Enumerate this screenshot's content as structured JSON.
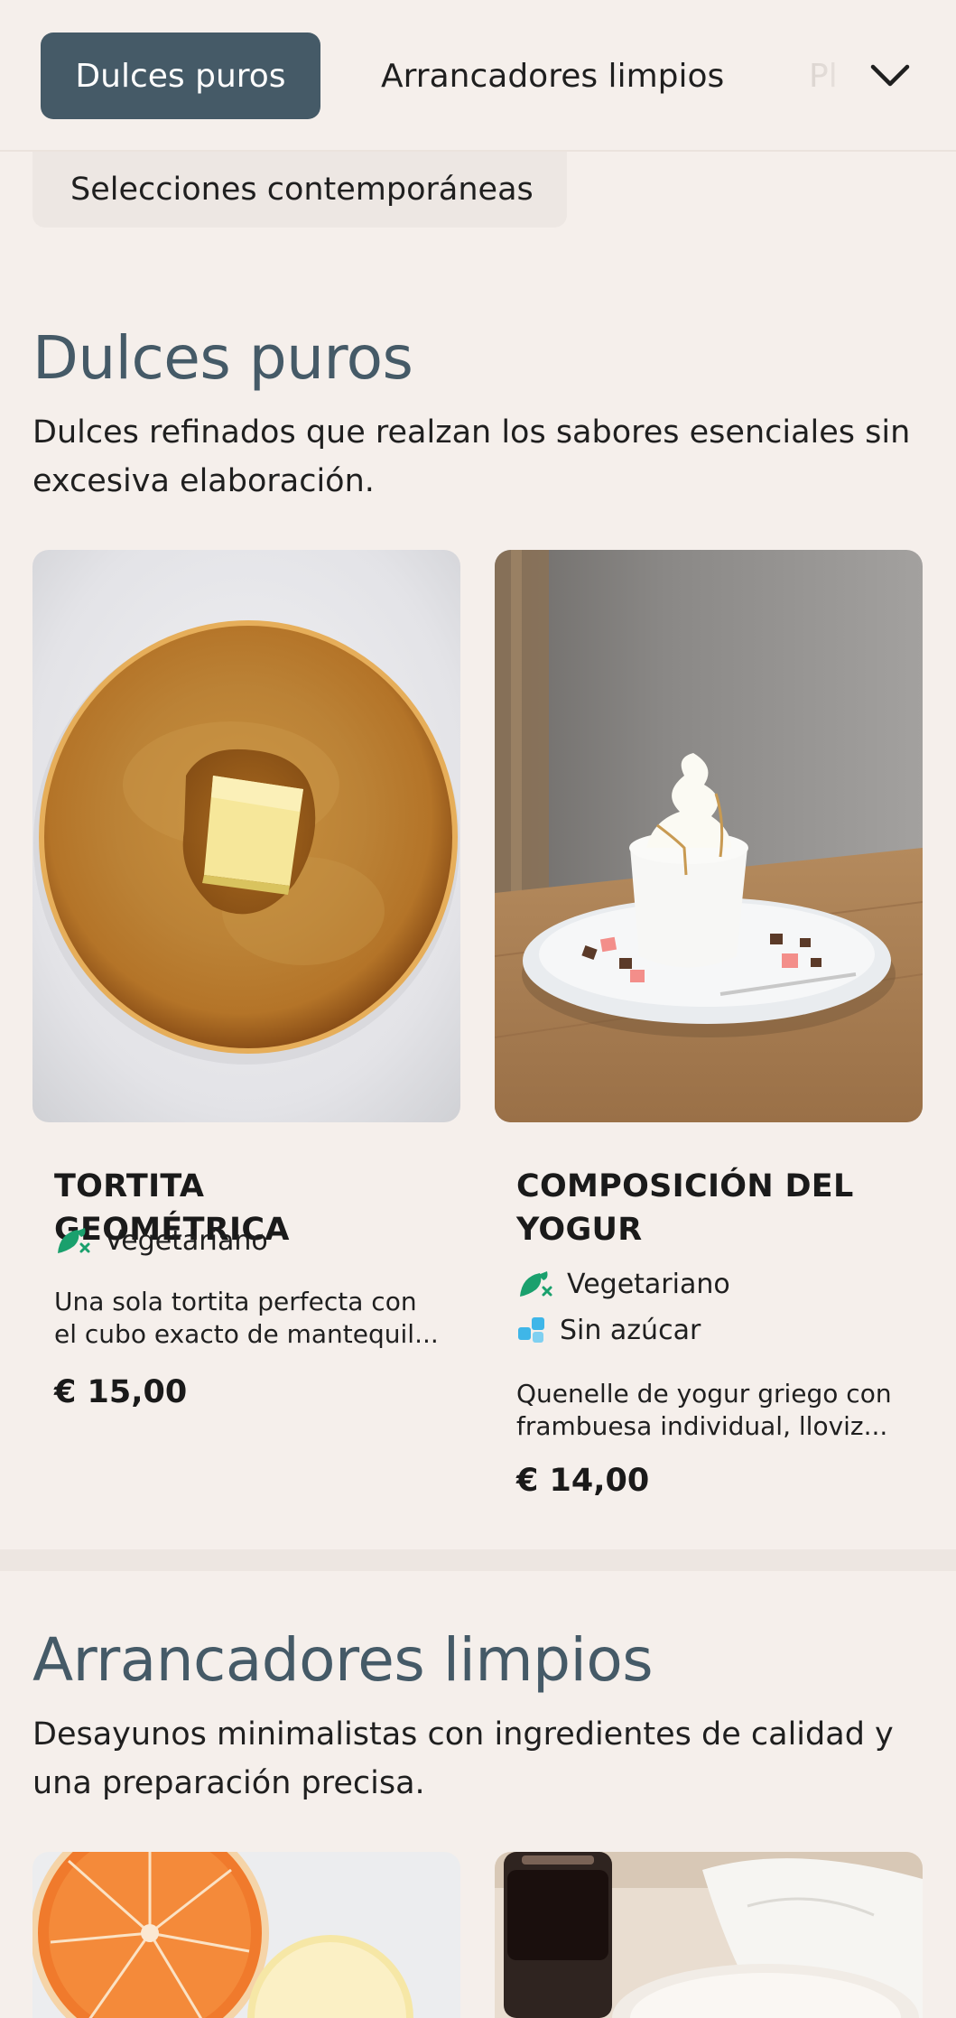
{
  "nav": {
    "tabs": [
      {
        "label": "Dulces puros",
        "active": true
      },
      {
        "label": "Arrancadores limpios",
        "active": false
      },
      {
        "label": "Pl",
        "active": false
      },
      {
        "label": "Selecciones contemporáneas",
        "active": false
      }
    ],
    "expand_icon": "chevron-down-icon"
  },
  "sections": [
    {
      "title": "Dulces puros",
      "description": "Dulces refinados que realzan los sabores esenciales sin excesiva elaboración.",
      "description_lines": [
        "Dulces refinados que realzan los sabores esenciales sin",
        "excesiva elaboración."
      ],
      "items": [
        {
          "name": "TORTITA GEOMÉTRICA",
          "tags": [
            {
              "icon": "leaf-drumstick-icon",
              "label": "Vegetariano"
            }
          ],
          "description_lines": [
            "Una sola tortita perfecta con",
            "el cubo exacto de mantequil..."
          ],
          "price": "€ 15,00"
        },
        {
          "name_lines": [
            "COMPOSICIÓN DEL",
            "YOGUR"
          ],
          "tags": [
            {
              "icon": "leaf-drumstick-icon",
              "label": "Vegetariano"
            },
            {
              "icon": "sugar-cubes-icon",
              "label": "Sin azúcar"
            }
          ],
          "description_lines": [
            "Quenelle de yogur griego con",
            "frambuesa individual, lloviz..."
          ],
          "price": "€ 14,00"
        }
      ]
    },
    {
      "title": "Arrancadores limpios",
      "description_lines": [
        "Desayunos minimalistas con ingredientes de calidad y",
        "una preparación precisa."
      ]
    }
  ],
  "colors": {
    "background": "#f5efeb",
    "accent": "#455a67",
    "vegetarian_icon": "#1aa06d",
    "sugar_free_icon": "#3fb6e8"
  }
}
